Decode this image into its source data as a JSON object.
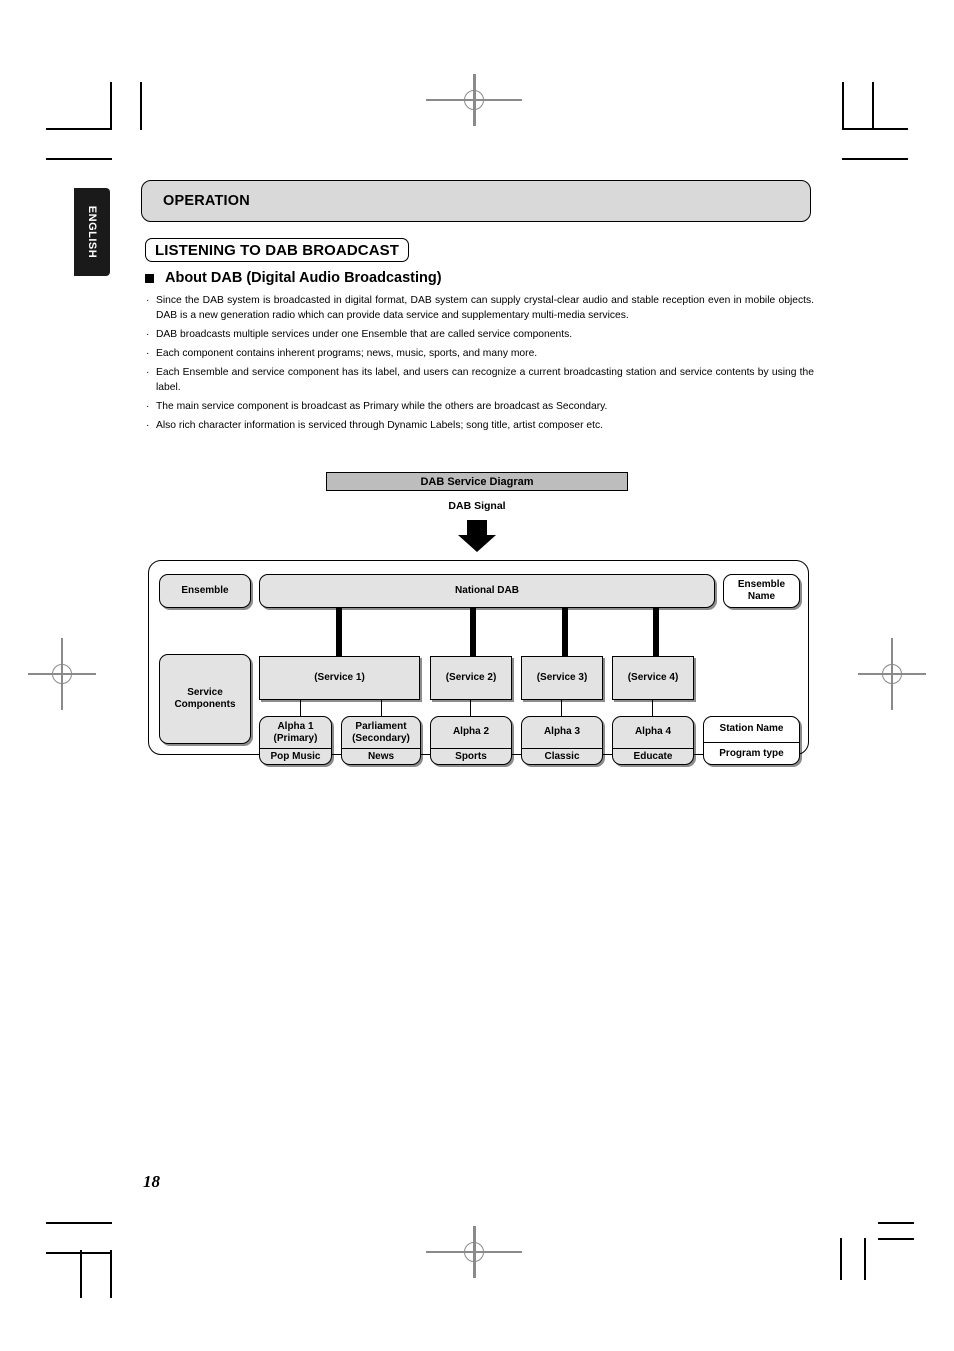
{
  "page": {
    "number": "18",
    "language_tab": "ENGLISH"
  },
  "header": {
    "operation_label": "OPERATION",
    "section_title": "LISTENING TO DAB BROADCAST",
    "subsection_title": "About DAB (Digital Audio Broadcasting)",
    "bullet_marker": "■"
  },
  "body": {
    "bullet_char": "·",
    "bullets": [
      "Since the DAB system is broadcasted in digital format, DAB system can supply crystal-clear audio and stable reception even in mobile objects. DAB is a new generation radio which can provide data service and supplementary multi-media services.",
      "DAB broadcasts multiple services under one Ensemble that are called service components.",
      "Each component contains inherent programs; news, music, sports, and many more.",
      "Each Ensemble and service component has its label, and users can recognize a current broadcasting station and service contents by using the label.",
      "The main service component is broadcast as Primary while the others are broadcast as Secondary.",
      "Also rich character information is serviced through Dynamic Labels; song title, artist composer etc."
    ]
  },
  "diagram": {
    "caption": "DAB Service Diagram",
    "signal_label": "DAB Signal",
    "row_labels": {
      "ensemble": "Ensemble",
      "service_components": "Service Components",
      "service_components_line1": "Service",
      "service_components_line2": "Components"
    },
    "ensemble_node": "National DAB",
    "right_labels": {
      "ensemble_name_line1": "Ensemble",
      "ensemble_name_line2": "Name",
      "station_name": "Station Name",
      "program_type": "Program type"
    },
    "services": [
      {
        "label": "(Service 1)"
      },
      {
        "label": "(Service 2)"
      },
      {
        "label": "(Service 3)"
      },
      {
        "label": "(Service 4)"
      }
    ],
    "components": [
      {
        "name_line1": "Alpha 1",
        "name_line2": "(Primary)",
        "genre": "Pop Music"
      },
      {
        "name_line1": "Parliament",
        "name_line2": "(Secondary)",
        "genre": "News"
      },
      {
        "name_line1": "Alpha 2",
        "name_line2": "",
        "genre": "Sports"
      },
      {
        "name_line1": "Alpha 3",
        "name_line2": "",
        "genre": "Classic"
      },
      {
        "name_line1": "Alpha 4",
        "name_line2": "",
        "genre": "Educate"
      }
    ]
  },
  "colors": {
    "header_bar": "#d9d9d9",
    "caption_bar": "#bdbdbd",
    "node_fill": "#e3e3e3",
    "tab_bg": "#1a1a1a",
    "line": "#000000"
  }
}
